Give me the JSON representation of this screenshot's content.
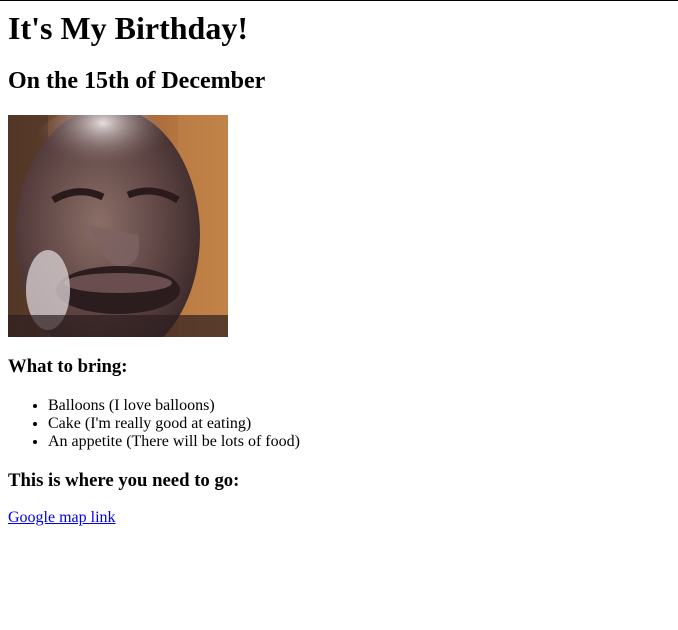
{
  "header": {
    "title": "It's My Birthday!",
    "subtitle": "On the 15th of December"
  },
  "photo": {
    "icon": "person-face-photo"
  },
  "bring": {
    "heading": "What to bring:",
    "items": [
      "Balloons (I love balloons)",
      "Cake (I'm really good at eating)",
      "An appetite (There will be lots of food)"
    ]
  },
  "location": {
    "heading": "This is where you need to go:",
    "link_label": "Google map link",
    "link_color": "#0000ee"
  }
}
